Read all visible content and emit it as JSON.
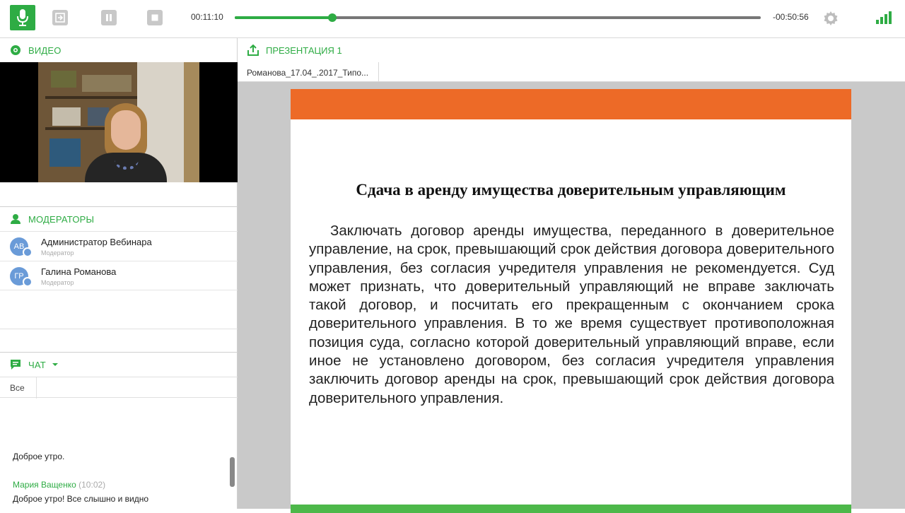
{
  "toolbar": {
    "time_elapsed": "00:11:10",
    "time_remaining": "-00:50:56",
    "progress_fraction": 0.185,
    "accent_color": "#2eac44"
  },
  "video_panel": {
    "title": "ВИДЕО"
  },
  "moderators_panel": {
    "title": "МОДЕРАТОРЫ",
    "items": [
      {
        "initials": "АВ",
        "name": "Администратор Вебинара",
        "role": "Модератор"
      },
      {
        "initials": "ГР",
        "name": "Галина Романова",
        "role": "Модератор"
      }
    ]
  },
  "chat_panel": {
    "title": "ЧАТ",
    "tab_all": "Все",
    "messages": [
      {
        "author": "",
        "time": "",
        "text": "Доброе утро."
      },
      {
        "author": "Мария Ващенко",
        "time": "(10:02)",
        "text": "Доброе утро! Все слышно и видно"
      }
    ]
  },
  "presentation": {
    "title": "ПРЕЗЕНТАЦИЯ 1",
    "tab_label": "Романова_17.04_.2017_Типо...",
    "slide": {
      "title": "Сдача в аренду имущества доверительным управляющим",
      "body": "Заключать договор аренды имущества, переданного в доверительное управление, на срок, превышающий срок действия договора доверительного управления, без согласия учредителя управления не рекомендуется. Суд может признать, что доверительный управляющий не вправе заключать такой договор, и посчитать его прекращенным с окончанием срока доверительного управления. В то же время существует противоположная позиция суда, согласно которой доверительный управляющий вправе, если иное не установлено договором, без согласия учредителя управления заключить договор аренды на срок, превышающий срок действия договора доверительного управления.",
      "top_bar_color": "#ed6a27",
      "bottom_bar_color": "#4db84a"
    }
  }
}
